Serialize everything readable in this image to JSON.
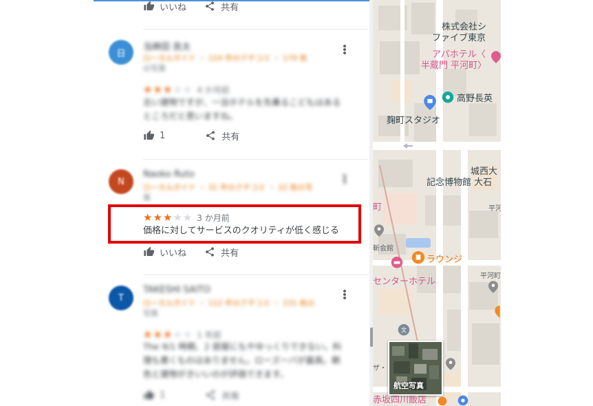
{
  "reviews_panel": {
    "top_actions": {
      "like_label": "いいね",
      "share_label": "共有"
    },
    "reviews": [
      {
        "avatar_letter": "日",
        "avatar_color": "#3b8fd6",
        "name": "当麻田 良太",
        "meta_line1": "ローカルガイド ・ 124 件のクチコミ ・ 179 枚",
        "meta_line2": "の写真",
        "stars_filled": 3,
        "date": "4 か月前",
        "text_line1": "古い建物ですが、一泊ホテルを先乗るこどもはある",
        "text_line2": "ところだと思いますね。",
        "like_label": "1",
        "share_label": "共有"
      },
      {
        "avatar_letter": "N",
        "avatar_color": "#c4481f",
        "name": "Naoko Ruto",
        "meta_line1": "ローカルガイド ・ 31 件のクチコミ ・ 22 枚の写",
        "meta_line2": "真",
        "stars_filled": 3,
        "date": "3 か月前",
        "text_line1": "価格に対してサービスのクオリティが低く感じる",
        "like_label": "いいね",
        "share_label": "共有"
      },
      {
        "avatar_letter": "T",
        "avatar_color": "#0b57a8",
        "name": "TAKESHI SAITO",
        "meta_line1": "ローカルガイド ・ 112 件のクチコミ ・ 231 枚の",
        "meta_line2": "写真",
        "stars_filled": 3,
        "date": "1 年前",
        "text_line1": "The 9/1 時期、2 部屋にもやゆっくりできない。料",
        "text_line2": "理も悪くものはありません。ローズ一バが最高。朝",
        "text_line3": "色と建物がきいいのが評価できます。",
        "like_label": "1",
        "share_label": "共有"
      }
    ]
  },
  "map": {
    "labels": {
      "company_1": "株式会社シ",
      "company_2": "ファイブ東京",
      "hotel_1": "アパホテル〈",
      "hotel_2": "半蔵門 平河町〉",
      "takano": "高野長英",
      "kojimachi": "麹町スタジオ",
      "museum_1": "城西大",
      "museum_2": "記念博物館 大石",
      "hirakawa_1": "平河",
      "hall": "斬会館",
      "lounge": "ラウンジ",
      "center_hotel": "センターホテル",
      "hirakawa_2": "平河町",
      "place_za": "ザ・",
      "place_ma": "町",
      "restaurant": "赤坂四川飯店"
    },
    "satellite_label": "航空写真"
  }
}
